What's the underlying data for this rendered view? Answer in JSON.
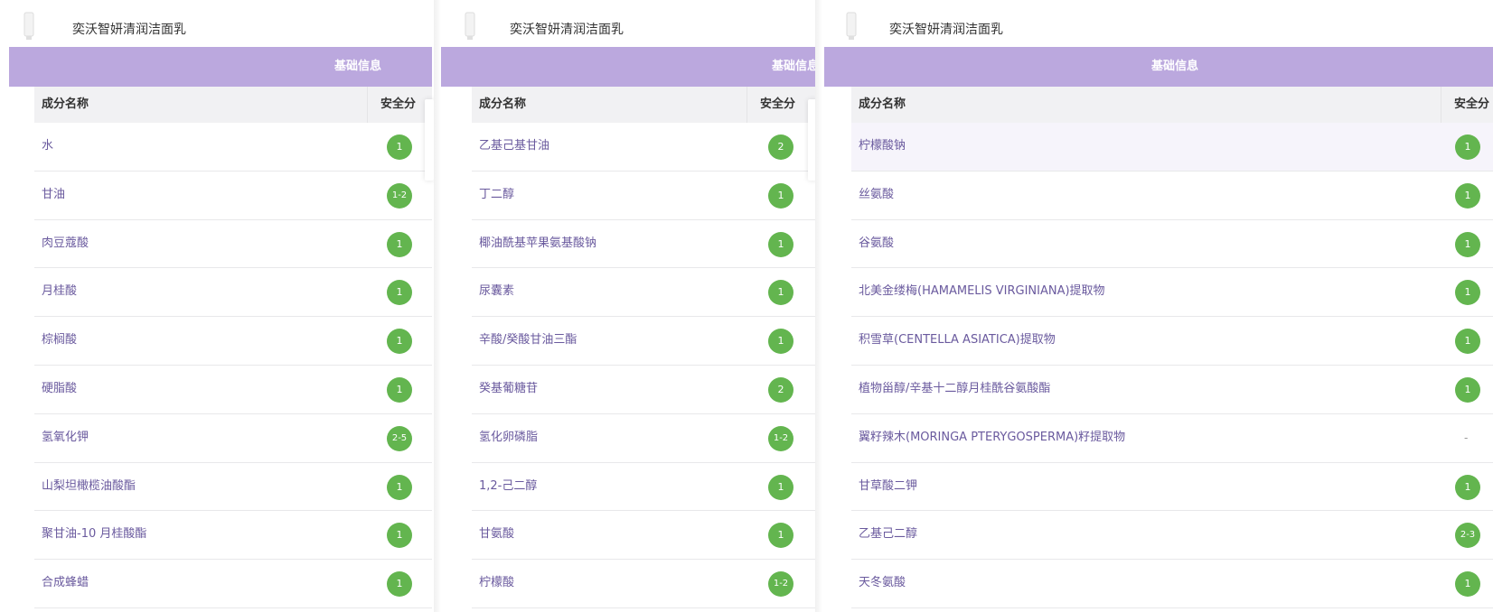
{
  "panels": [
    {
      "product_name": "奕沃智妍清润洁面乳",
      "section_title": "基础信息",
      "col_name": "成分名称",
      "col_score": "安全分",
      "rows": [
        {
          "name": "水",
          "score": "1"
        },
        {
          "name": "甘油",
          "score": "1-2"
        },
        {
          "name": "肉豆蔻酸",
          "score": "1"
        },
        {
          "name": "月桂酸",
          "score": "1"
        },
        {
          "name": "棕榈酸",
          "score": "1"
        },
        {
          "name": "硬脂酸",
          "score": "1"
        },
        {
          "name": "氢氧化钾",
          "score": "2-5"
        },
        {
          "name": "山梨坦橄榄油酸酯",
          "score": "1"
        },
        {
          "name": "聚甘油-10 月桂酸酯",
          "score": "1"
        },
        {
          "name": "合成蜂蜡",
          "score": "1"
        }
      ]
    },
    {
      "product_name": "奕沃智妍清润洁面乳",
      "section_title": "基础信息",
      "col_name": "成分名称",
      "col_score": "安全分",
      "rows": [
        {
          "name": "乙基己基甘油",
          "score": "2"
        },
        {
          "name": "丁二醇",
          "score": "1"
        },
        {
          "name": "椰油酰基苹果氨基酸钠",
          "score": "1"
        },
        {
          "name": "尿囊素",
          "score": "1"
        },
        {
          "name": "辛酸/癸酸甘油三酯",
          "score": "1"
        },
        {
          "name": "癸基葡糖苷",
          "score": "2"
        },
        {
          "name": "氢化卵磷脂",
          "score": "1-2"
        },
        {
          "name": "1,2-己二醇",
          "score": "1"
        },
        {
          "name": "甘氨酸",
          "score": "1"
        },
        {
          "name": "柠檬酸",
          "score": "1-2"
        }
      ]
    },
    {
      "product_name": "奕沃智妍清润洁面乳",
      "section_title": "基础信息",
      "col_name": "成分名称",
      "col_score": "安全分",
      "rows": [
        {
          "name": "柠檬酸钠",
          "score": "1"
        },
        {
          "name": "丝氨酸",
          "score": "1"
        },
        {
          "name": "谷氨酸",
          "score": "1"
        },
        {
          "name": "北美金缕梅(HAMAMELIS VIRGINIANA)提取物",
          "score": "1"
        },
        {
          "name": "积雪草(CENTELLA ASIATICA)提取物",
          "score": "1"
        },
        {
          "name": "植物甾醇/辛基十二醇月桂酰谷氨酸酯",
          "score": "1"
        },
        {
          "name": "翼籽辣木(MORINGA PTERYGOSPERMA)籽提取物",
          "score": "-"
        },
        {
          "name": "甘草酸二钾",
          "score": "1"
        },
        {
          "name": "乙基己二醇",
          "score": "2-3"
        },
        {
          "name": "天冬氨酸",
          "score": "1"
        }
      ]
    }
  ],
  "colors": {
    "banner": "#bba8de",
    "badge": "#63b54f",
    "ingredient_text": "#6a5a9e"
  }
}
